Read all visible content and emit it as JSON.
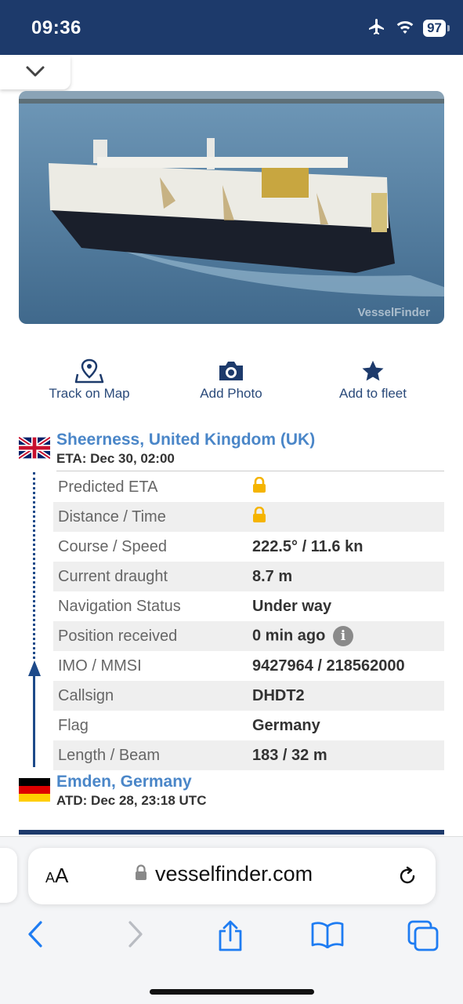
{
  "status_bar": {
    "time": "09:36",
    "battery": "97"
  },
  "photo": {
    "watermark": "VesselFinder"
  },
  "actions": [
    {
      "label": "Track on Map",
      "icon": "map-pin-icon"
    },
    {
      "label": "Add Photo",
      "icon": "camera-icon"
    },
    {
      "label": "Add to fleet",
      "icon": "star-icon"
    }
  ],
  "voyage": {
    "destination": {
      "name": "Sheerness, United Kingdom (UK)",
      "time": "ETA: Dec 30, 02:00",
      "flag": "uk-flag"
    },
    "origin": {
      "name": "Emden, Germany",
      "time": "ATD: Dec 28, 23:18 UTC",
      "flag": "germany-flag"
    }
  },
  "details": [
    {
      "key": "Predicted ETA",
      "value": "",
      "locked": true
    },
    {
      "key": "Distance / Time",
      "value": "",
      "locked": true
    },
    {
      "key": "Course / Speed",
      "value": "222.5° / 11.6 kn"
    },
    {
      "key": "Current draught",
      "value": "8.7 m"
    },
    {
      "key": "Navigation Status",
      "value": "Under way"
    },
    {
      "key": "Position received",
      "value": "0 min ago",
      "info": "i"
    },
    {
      "key": "IMO / MMSI",
      "value": "9427964 / 218562000"
    },
    {
      "key": "Callsign",
      "value": "DHDT2"
    },
    {
      "key": "Flag",
      "value": "Germany"
    },
    {
      "key": "Length / Beam",
      "value": "183 / 32 m"
    }
  ],
  "browser": {
    "aa_label_small": "A",
    "aa_label_big": "A",
    "url": "vesselfinder.com"
  },
  "colors": {
    "navy": "#1d3a6b",
    "link_blue": "#4a86c8",
    "lock_yellow": "#f5b400"
  }
}
